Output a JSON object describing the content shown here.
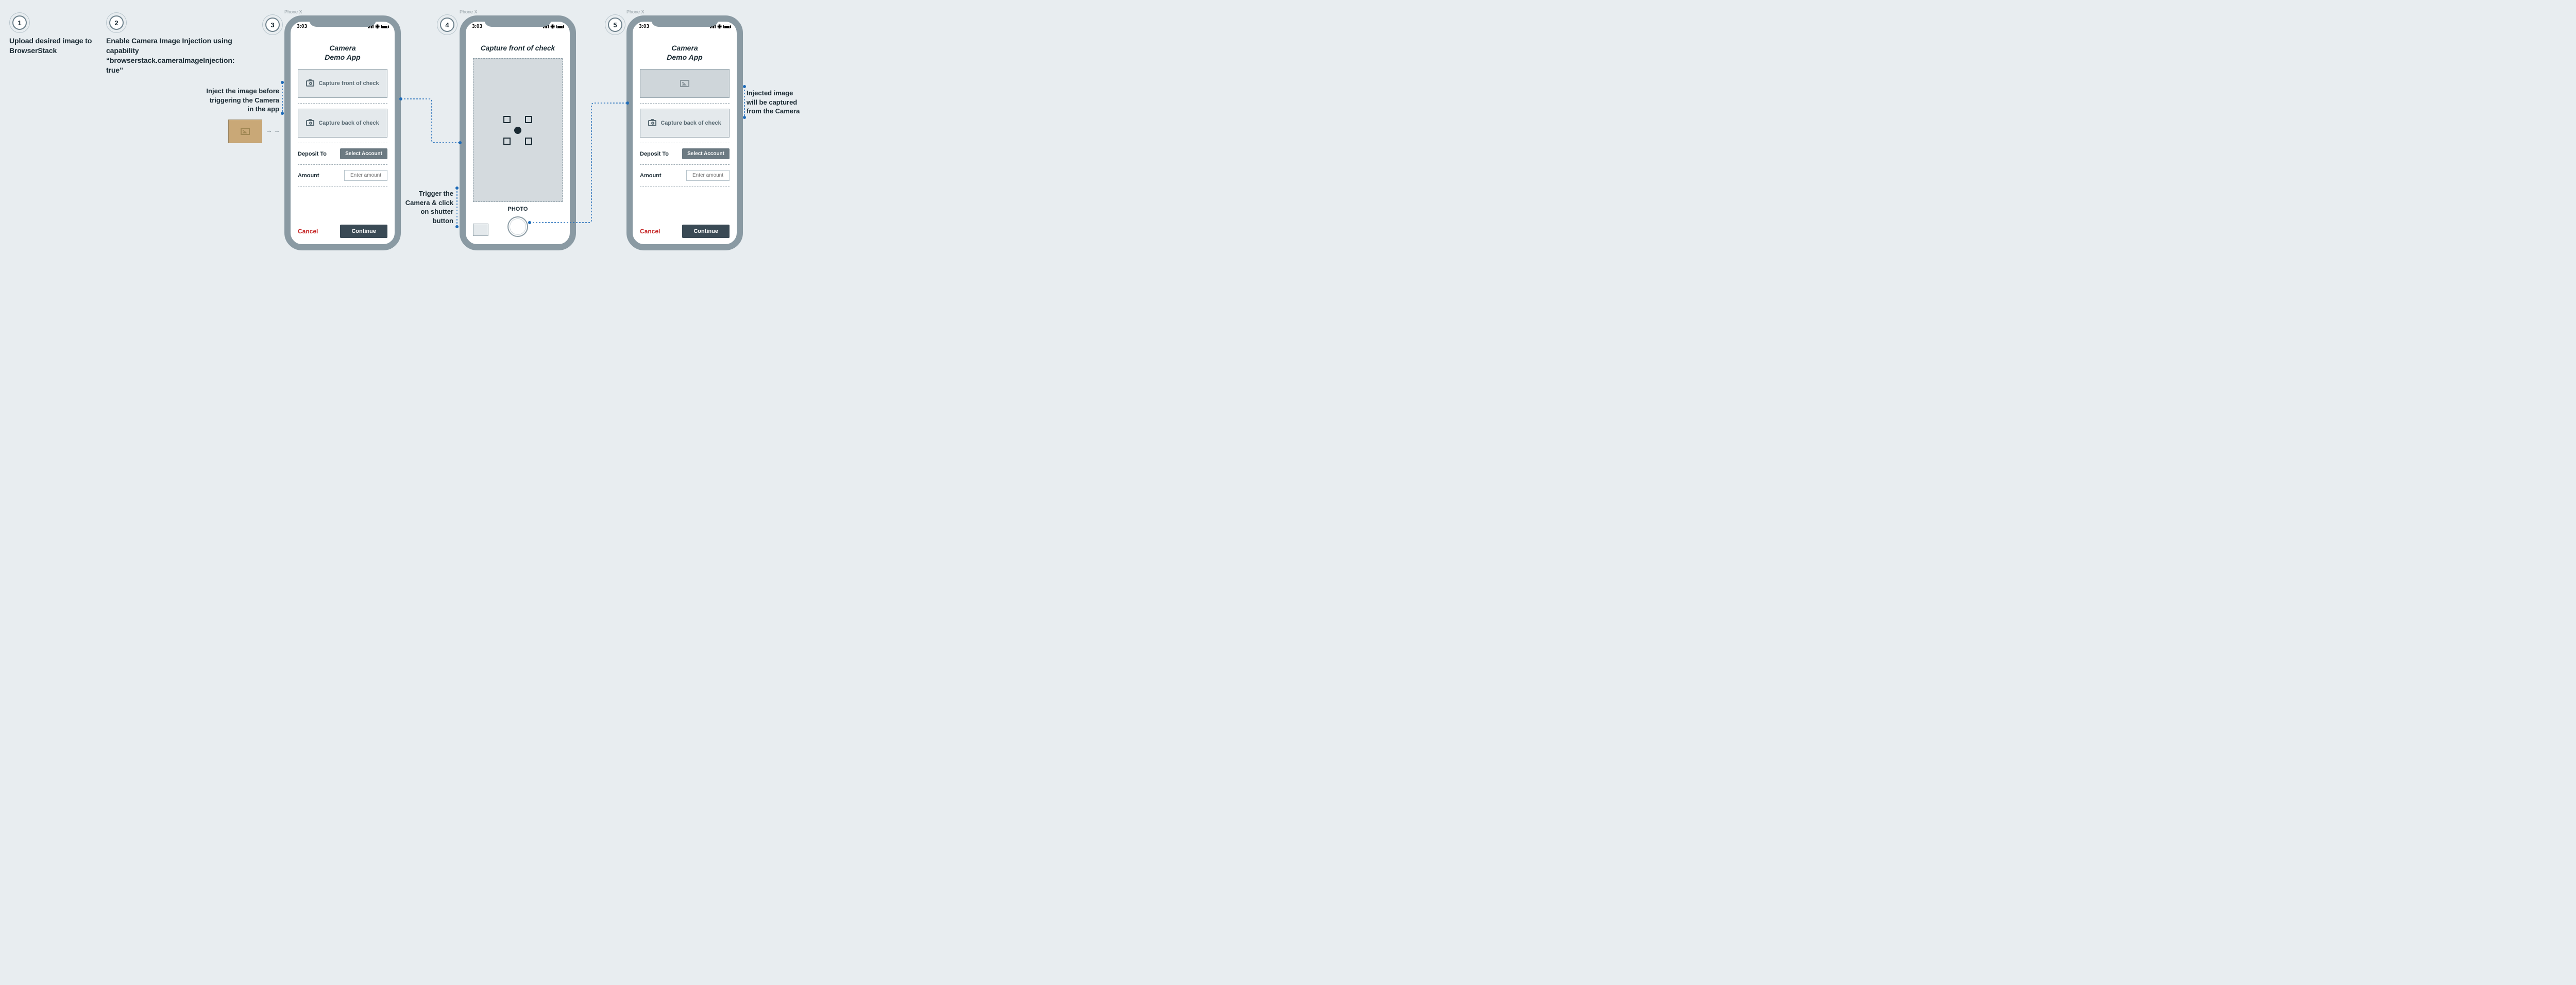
{
  "steps": {
    "s1": {
      "num": "1",
      "text": "Upload desired image to BrowserStack"
    },
    "s2": {
      "num": "2",
      "text": "Enable Camera Image Injection using capability “browserstack.cameraImageInjection: true”"
    },
    "s3": {
      "num": "3"
    },
    "s4": {
      "num": "4"
    },
    "s5": {
      "num": "5"
    }
  },
  "captions": {
    "inject": "Inject the image before triggering the Camera in the app",
    "trigger": "Trigger the Camera & click on shutter button",
    "result": "Injected image will be captured from the Camera"
  },
  "phone": {
    "model_label": "Phone X",
    "clock": "3:03",
    "app_title_line1": "Camera",
    "app_title_line2": "Demo App",
    "capture_front": "Capture front of check",
    "capture_back": "Capture back of check",
    "deposit_label": "Deposit To",
    "select_account": "Select Account",
    "amount_label": "Amount",
    "amount_placeholder": "Enter amount",
    "cancel": "Cancel",
    "continue": "Continue",
    "photo_label": "PHOTO"
  }
}
